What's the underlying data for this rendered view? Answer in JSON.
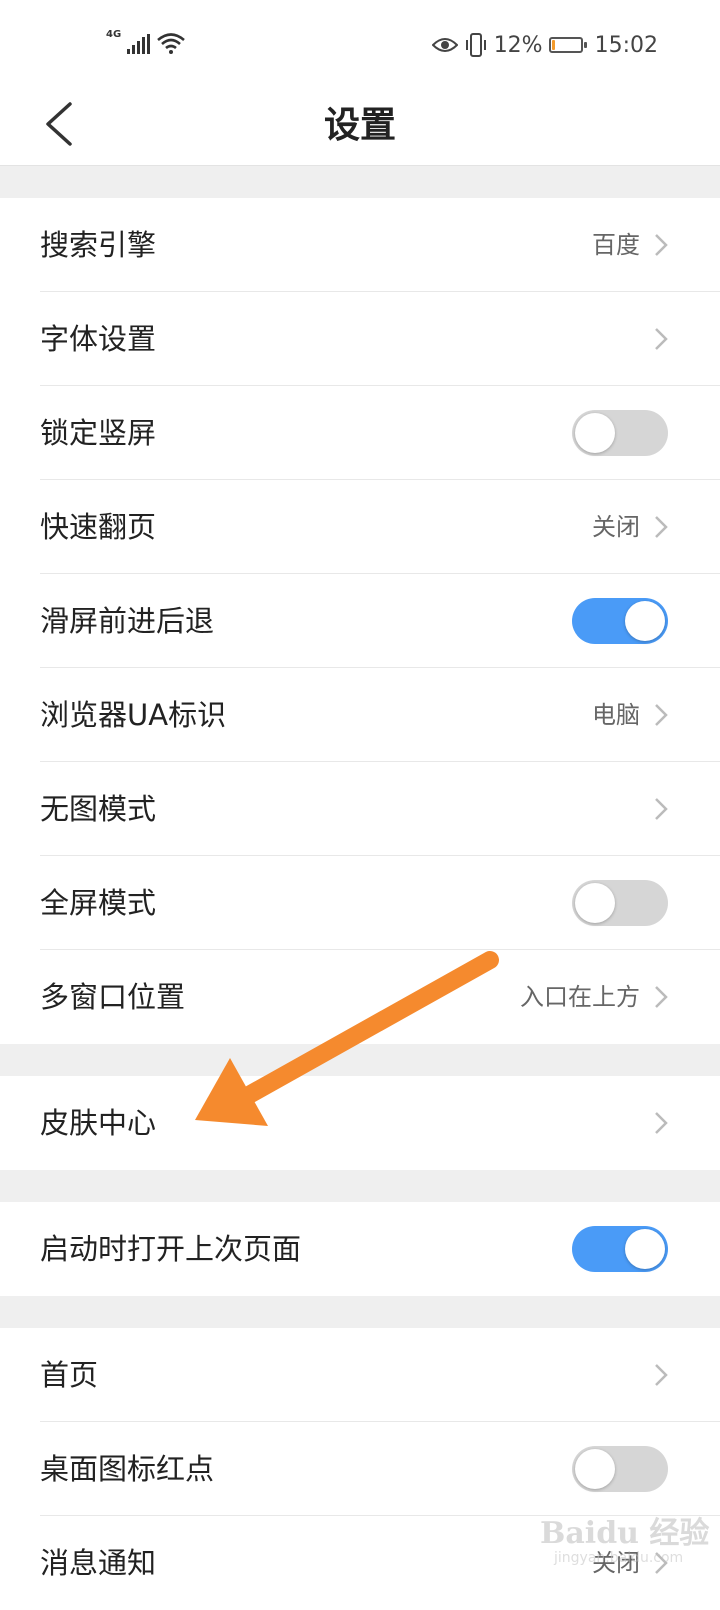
{
  "status_bar": {
    "network": "4G",
    "battery_percent": "12%",
    "battery_level": 0.12,
    "time": "15:02",
    "icons": [
      "signal-icon",
      "wifi-icon",
      "eye-icon",
      "vibrate-icon",
      "battery-icon"
    ]
  },
  "header": {
    "title": "设置",
    "back_icon": "back-arrow-icon"
  },
  "settings": {
    "group1": [
      {
        "label": "搜索引擎",
        "value": "百度",
        "type": "link"
      },
      {
        "label": "字体设置",
        "value": "",
        "type": "link"
      },
      {
        "label": "锁定竖屏",
        "type": "toggle",
        "on": false
      },
      {
        "label": "快速翻页",
        "value": "关闭",
        "type": "link"
      },
      {
        "label": "滑屏前进后退",
        "type": "toggle",
        "on": true
      },
      {
        "label": "浏览器UA标识",
        "value": "电脑",
        "type": "link"
      },
      {
        "label": "无图模式",
        "value": "",
        "type": "link"
      },
      {
        "label": "全屏模式",
        "type": "toggle",
        "on": false
      },
      {
        "label": "多窗口位置",
        "value": "入口在上方",
        "type": "link"
      }
    ],
    "group2": [
      {
        "label": "皮肤中心",
        "value": "",
        "type": "link"
      }
    ],
    "group3": [
      {
        "label": "启动时打开上次页面",
        "type": "toggle",
        "on": true
      }
    ],
    "group4": [
      {
        "label": "首页",
        "value": "",
        "type": "link"
      },
      {
        "label": "桌面图标红点",
        "type": "toggle",
        "on": false
      },
      {
        "label": "消息通知",
        "value": "关闭",
        "type": "link"
      }
    ]
  },
  "annotation": {
    "arrow_color": "#f58a2e"
  },
  "watermark": {
    "text": "Baidu 经验",
    "sub": "jingyan.baidu.com"
  },
  "colors": {
    "toggle_on": "#4a9bf7",
    "toggle_off": "#d6d6d6",
    "section_gap": "#efefef"
  }
}
